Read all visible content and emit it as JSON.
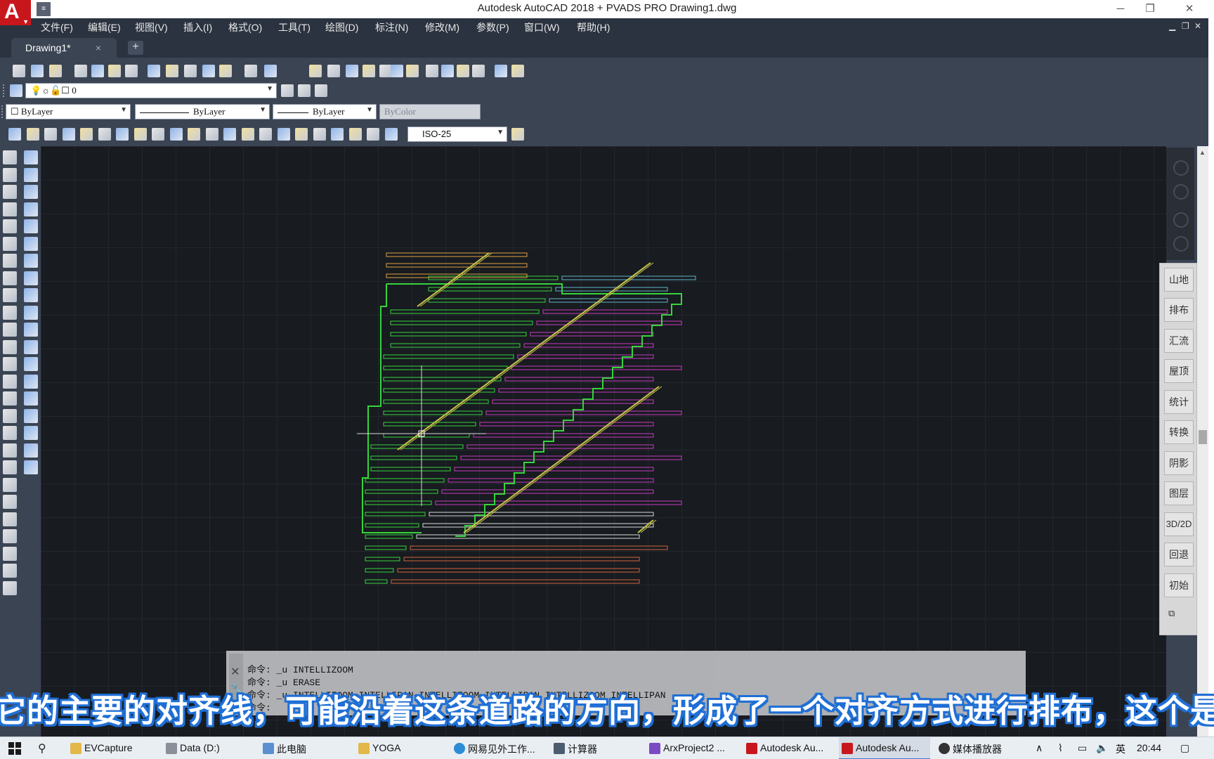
{
  "titlebar": {
    "title": "Autodesk AutoCAD 2018  +  PVADS PRO      Drawing1.dwg",
    "logo_letter": "A",
    "minimize_icon": "─",
    "restore_icon": "❐",
    "close_icon": "✕"
  },
  "menu": {
    "items": [
      "文件(F)",
      "编辑(E)",
      "视图(V)",
      "插入(I)",
      "格式(O)",
      "工具(T)",
      "绘图(D)",
      "标注(N)",
      "修改(M)",
      "参数(P)",
      "窗口(W)",
      "帮助(H)"
    ]
  },
  "tabs": {
    "active_label": "Drawing1*",
    "close_glyph": "×",
    "new_glyph": "+"
  },
  "toolbar": {
    "layer_value": "0",
    "color_value": "ByLayer",
    "linetype_value": "ByLayer",
    "lineweight_value": "ByLayer",
    "plotstyle_value": "ByColor",
    "dimstyle_value": "ISO-25"
  },
  "side_panel": {
    "buttons": [
      "山地",
      "排布",
      "汇流",
      "屋顶",
      "统计",
      "转换",
      "阴影",
      "图层",
      "3D/2D",
      "回退",
      "初始"
    ]
  },
  "command_line": {
    "history": [
      "命令: _u INTELLIZOOM",
      "命令: _u ERASE",
      "命令: _u INTELLIZOOM INTELLIPAN INTELLIZOOM INTELLIPAN INTELLIZOOM INTELLIPAN",
      "命令:"
    ]
  },
  "subtitle": {
    "text": "它的主要的对齐线，可能沿着这条道路的方向，形成了一个对齐方式进行排布，这个是"
  },
  "taskbar": {
    "items": [
      "EVCapture",
      "Data (D:)",
      "此电脑",
      "YOGA",
      "网易见外工作...",
      "计算器",
      "ArxProject2 ...",
      "Autodesk Au...",
      "Autodesk Au...",
      "媒体播放器"
    ],
    "ime": "英",
    "time": "20:44"
  },
  "colors": {
    "boundary": "#36d43c",
    "road": "#c9c64a",
    "panel_orange": "#e0a040",
    "panel_cyan": "#5fb6c8",
    "panel_magenta": "#c93ac0",
    "panel_white": "#d8d8d8",
    "panel_red_brown": "#d0643a",
    "canvas_bg": "#181b20"
  }
}
